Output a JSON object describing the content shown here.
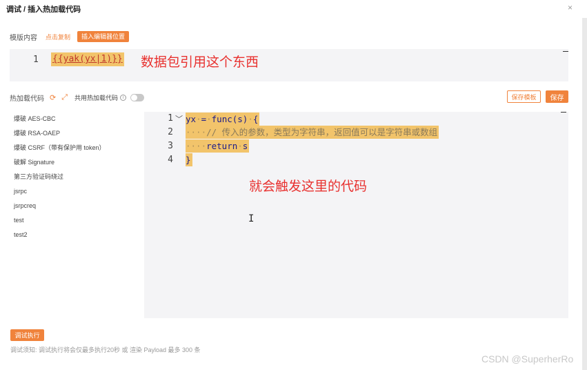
{
  "dialog": {
    "title": "调试 / 插入热加载代码",
    "close_glyph": "×"
  },
  "template_section": {
    "label": "模版内容",
    "copy_link": "点击复制",
    "insert_button": "插入编辑器位置",
    "editor": {
      "line_number": "1",
      "code": "{{yak(yx|1)}}"
    },
    "annotation": "数据包引用这个东西"
  },
  "hotload_section": {
    "label": "热加载代码",
    "share_label": "共用热加载代码",
    "share_enabled": false,
    "save_template_button": "保存模板",
    "save_button": "保存"
  },
  "code_list": [
    "爆破 AES-CBC",
    "爆破 RSA-OAEP",
    "爆破 CSRF（带有保护用 token）",
    "破解 Signature",
    "第三方验证码绕过",
    "jsrpc",
    "jsrpcreq",
    "test",
    "test2"
  ],
  "code_editor": {
    "line_numbers": [
      "1",
      "2",
      "3",
      "4"
    ],
    "line1": {
      "var": "yx",
      "op": "=",
      "fn": "func(s)",
      "brace": "{"
    },
    "line2": {
      "comment": "// 传入的参数，类型为字符串，返回值可以是字符串或数组"
    },
    "line3": {
      "kw": "return",
      "var": "s"
    },
    "line4": {
      "brace": "}"
    },
    "annotation": "就会触发这里的代码"
  },
  "footer": {
    "run_button": "调试执行",
    "note": "调试须知: 调试执行将会仅最多执行20秒 或 渲染 Payload 最多 300 条"
  },
  "watermark": "CSDN @SuperherRo",
  "colors": {
    "accent": "#f0833c",
    "highlight": "#f2c46b",
    "annotation": "#e8312f"
  }
}
